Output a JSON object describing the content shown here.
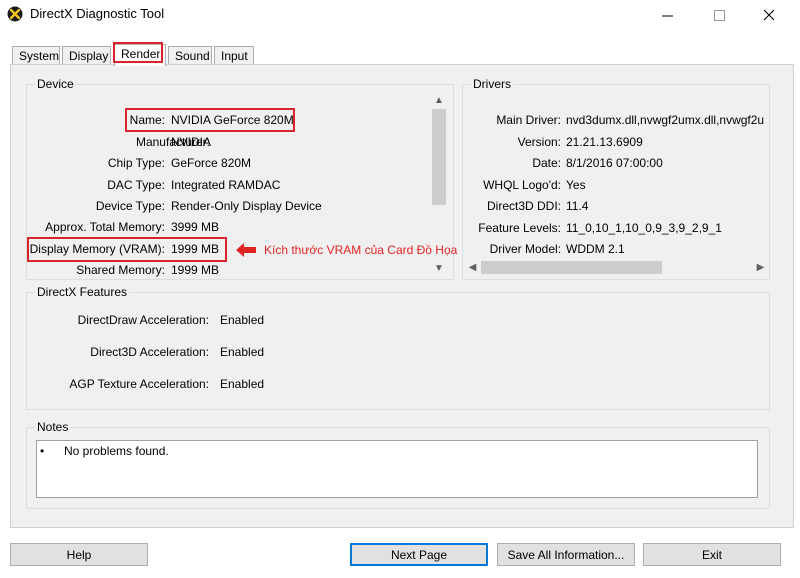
{
  "window": {
    "title": "DirectX Diagnostic Tool",
    "minimize": "—",
    "maximize": "☐",
    "close": "✕"
  },
  "tabs": [
    {
      "label": "System"
    },
    {
      "label": "Display"
    },
    {
      "label": "Render",
      "active": true
    },
    {
      "label": "Sound"
    },
    {
      "label": "Input"
    }
  ],
  "device": {
    "title": "Device",
    "rows": [
      {
        "label": "Name:",
        "value": "NVIDIA GeForce 820M"
      },
      {
        "label": "Manufacturer:",
        "value": "NVIDIA"
      },
      {
        "label": "Chip Type:",
        "value": "GeForce 820M"
      },
      {
        "label": "DAC Type:",
        "value": "Integrated RAMDAC"
      },
      {
        "label": "Device Type:",
        "value": "Render-Only Display Device"
      },
      {
        "label": "Approx. Total Memory:",
        "value": "3999 MB"
      },
      {
        "label": "Display Memory (VRAM):",
        "value": "1999 MB"
      },
      {
        "label": "Shared Memory:",
        "value": "1999 MB"
      }
    ]
  },
  "drivers": {
    "title": "Drivers",
    "rows": [
      {
        "label": "Main Driver:",
        "value": "nvd3dumx.dll,nvwgf2umx.dll,nvwgf2u"
      },
      {
        "label": "Version:",
        "value": "21.21.13.6909"
      },
      {
        "label": "Date:",
        "value": "8/1/2016 07:00:00"
      },
      {
        "label": "WHQL Logo'd:",
        "value": "Yes"
      },
      {
        "label": "Direct3D DDI:",
        "value": "11.4"
      },
      {
        "label": "Feature Levels:",
        "value": "11_0,10_1,10_0,9_3,9_2,9_1"
      },
      {
        "label": "Driver Model:",
        "value": "WDDM 2.1"
      }
    ]
  },
  "features": {
    "title": "DirectX Features",
    "rows": [
      {
        "label": "DirectDraw Acceleration:",
        "value": "Enabled"
      },
      {
        "label": "Direct3D Acceleration:",
        "value": "Enabled"
      },
      {
        "label": "AGP Texture Acceleration:",
        "value": "Enabled"
      }
    ]
  },
  "notes": {
    "title": "Notes",
    "bullet": "•",
    "text": "No problems found."
  },
  "annotation": {
    "text": "Kích thước VRAM của Card Đồ Họa",
    "color": "#e02424"
  },
  "buttons": {
    "help": "Help",
    "next_page": "Next Page",
    "save_all": "Save All Information...",
    "exit": "Exit"
  },
  "scroll": {
    "up": "▲",
    "down": "▼",
    "left": "◀",
    "right": "▶"
  }
}
